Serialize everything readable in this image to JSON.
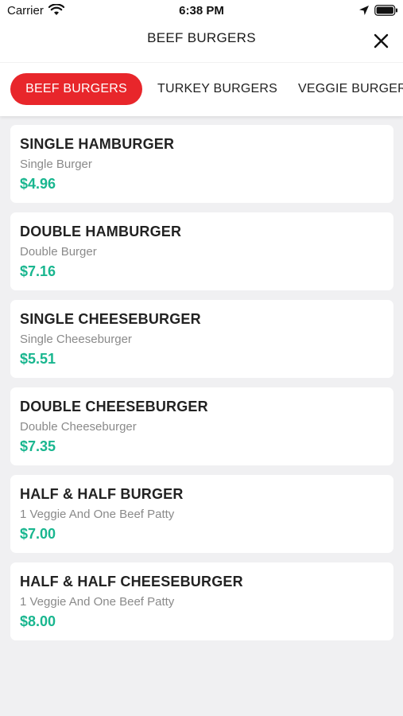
{
  "status_bar": {
    "carrier": "Carrier",
    "time": "6:38 PM",
    "icons": [
      "wifi-icon",
      "location-arrow-icon",
      "battery-icon"
    ]
  },
  "nav": {
    "title": "BEEF BURGERS",
    "close_icon": "close-icon"
  },
  "tabs": [
    {
      "label": "BEEF BURGERS",
      "active": true
    },
    {
      "label": "TURKEY BURGERS",
      "active": false
    },
    {
      "label": "VEGGIE BURGERS",
      "active": false
    }
  ],
  "items": [
    {
      "name": "SINGLE HAMBURGER",
      "description": "Single Burger",
      "price": "$4.96"
    },
    {
      "name": "DOUBLE HAMBURGER",
      "description": "Double Burger",
      "price": "$7.16"
    },
    {
      "name": "SINGLE CHEESEBURGER",
      "description": "Single Cheeseburger",
      "price": "$5.51"
    },
    {
      "name": "DOUBLE CHEESEBURGER",
      "description": "Double Cheeseburger",
      "price": "$7.35"
    },
    {
      "name": "HALF & HALF BURGER",
      "description": "1 Veggie And One Beef Patty",
      "price": "$7.00"
    },
    {
      "name": "HALF & HALF CHEESEBURGER",
      "description": "1 Veggie And One Beef Patty",
      "price": "$8.00"
    }
  ],
  "colors": {
    "accent": "#e8262b",
    "price": "#19b68f",
    "background": "#f0f0f2"
  }
}
